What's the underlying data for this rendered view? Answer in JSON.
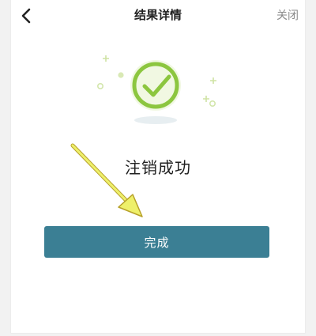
{
  "header": {
    "title": "结果详情",
    "close_label": "关闭",
    "back_icon": "chevron-left-icon"
  },
  "result": {
    "icon": "success-check-icon",
    "status_text": "注销成功"
  },
  "footer": {
    "done_label": "完成"
  },
  "colors": {
    "check_green": "#8cc63f",
    "button": "#3b7f94",
    "arrow_yellow": "#eef06a"
  }
}
